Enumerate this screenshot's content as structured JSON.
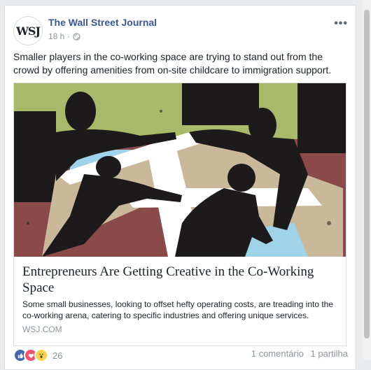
{
  "post": {
    "page_name": "The Wall Street Journal",
    "avatar_text": "WSJ",
    "time": "18 h",
    "separator": "·",
    "more": "•••",
    "message": "Smaller players in the co-working space are trying to stand out from the crowd by offering amenities from on-site childcare to immigration support."
  },
  "link": {
    "title": "Entrepreneurs Are Getting Creative in the Co-Working Space",
    "description": "Some small businesses, looking to offset hefty operating costs, are treading into the co-working arena, catering to specific industries and offering unique services.",
    "domain": "WSJ.COM"
  },
  "footer": {
    "reaction_count": "26",
    "comments": "1 comentário",
    "shares": "1 partilha"
  },
  "colors": {
    "brand_blue": "#365899",
    "art_green": "#a9b96a",
    "art_red": "#8a4a4a",
    "art_sky": "#9fd3ea"
  }
}
